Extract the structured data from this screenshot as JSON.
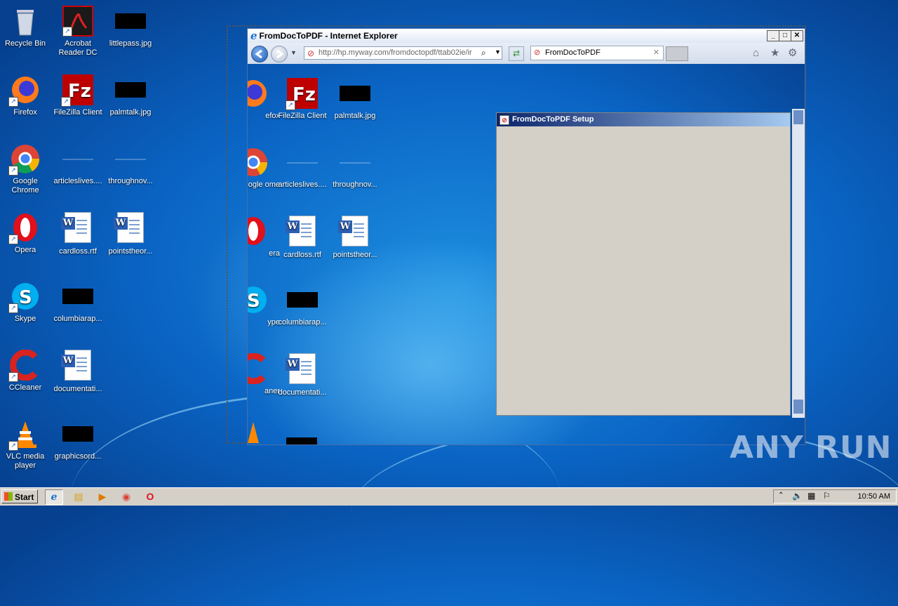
{
  "desktop_icons": [
    {
      "id": "recycle-bin",
      "label": "Recycle Bin"
    },
    {
      "id": "acrobat",
      "label": "Acrobat Reader DC"
    },
    {
      "id": "littlepass",
      "label": "littlepass.jpg"
    },
    {
      "id": "firefox",
      "label": "Firefox"
    },
    {
      "id": "filezilla",
      "label": "FileZilla Client"
    },
    {
      "id": "palmtalk",
      "label": "palmtalk.jpg"
    },
    {
      "id": "chrome",
      "label": "Google Chrome"
    },
    {
      "id": "articleslives",
      "label": "articleslives...."
    },
    {
      "id": "throughnov",
      "label": "throughnov..."
    },
    {
      "id": "opera",
      "label": "Opera"
    },
    {
      "id": "cardloss",
      "label": "cardloss.rtf"
    },
    {
      "id": "pointstheor",
      "label": "pointstheor..."
    },
    {
      "id": "skype",
      "label": "Skype"
    },
    {
      "id": "columbiarap",
      "label": "columbiarap..."
    },
    {
      "id": "ccleaner",
      "label": "CCleaner"
    },
    {
      "id": "documentati",
      "label": "documentati..."
    },
    {
      "id": "vlc",
      "label": "VLC media player"
    },
    {
      "id": "graphicsord",
      "label": "graphicsord..."
    }
  ],
  "browser": {
    "title": "FromDocToPDF - Internet Explorer",
    "address": "http://hp.myway.com/fromdoctopdf/ttab02ie/ir",
    "address_domain": "hp.myway.com",
    "tab_label": "FromDocToPDF",
    "content_icons": [
      {
        "label": "efox"
      },
      {
        "label": "FileZilla Client"
      },
      {
        "label": "palmtalk.jpg"
      },
      {
        "label": "ogle ome"
      },
      {
        "label": "articleslives...."
      },
      {
        "label": "throughnov..."
      },
      {
        "label": "era"
      },
      {
        "label": "cardloss.rtf"
      },
      {
        "label": "pointstheor..."
      },
      {
        "label": "ype"
      },
      {
        "label": "columbiarap..."
      },
      {
        "label": "aner"
      },
      {
        "label": "documentati..."
      }
    ]
  },
  "setup_dialog": {
    "title": "FromDocToPDF Setup"
  },
  "taskbar": {
    "start_label": "Start",
    "clock": "10:50 AM"
  },
  "watermark": "ANY RUN",
  "colors": {
    "titlebar_dark": "#0a246a",
    "titlebar_light": "#a6caf0",
    "desktop": "#0a64c4"
  }
}
